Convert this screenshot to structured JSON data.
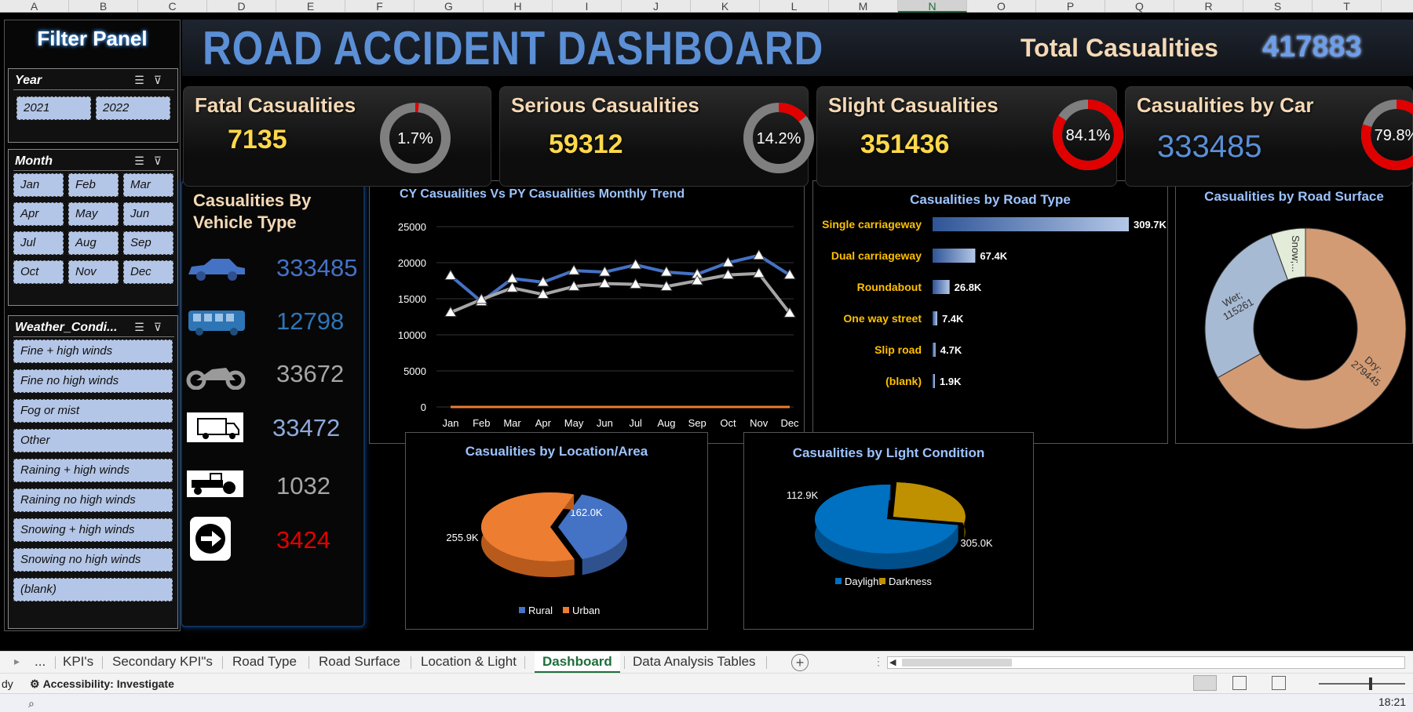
{
  "columns": [
    "A",
    "B",
    "C",
    "D",
    "E",
    "F",
    "G",
    "H",
    "I",
    "J",
    "K",
    "L",
    "M",
    "N",
    "O",
    "P",
    "Q",
    "R",
    "S",
    "T"
  ],
  "filter_panel": {
    "title": "Filter Panel"
  },
  "slicers": {
    "year": {
      "title": "Year",
      "items": [
        "2021",
        "2022"
      ]
    },
    "month": {
      "title": "Month",
      "items": [
        "Jan",
        "Feb",
        "Mar",
        "Apr",
        "May",
        "Jun",
        "Jul",
        "Aug",
        "Sep",
        "Oct",
        "Nov",
        "Dec"
      ]
    },
    "weather": {
      "title": "Weather_Condi...",
      "items": [
        "Fine + high winds",
        "Fine no high winds",
        "Fog or mist",
        "Other",
        "Raining + high winds",
        "Raining no high winds",
        "Snowing + high winds",
        "Snowing no high winds",
        "(blank)"
      ]
    }
  },
  "header": {
    "title": "ROAD ACCIDENT DASHBOARD",
    "total_label": "Total Casualities",
    "total_value": "417883"
  },
  "kpis": [
    {
      "title": "Fatal Casualities",
      "value": "7135",
      "pct_label": "1.7%",
      "pct": 1.7
    },
    {
      "title": "Serious Casualities",
      "value": "59312",
      "pct_label": "14.2%",
      "pct": 14.2
    },
    {
      "title": "Slight Casualities",
      "value": "351436",
      "pct_label": "84.1%",
      "pct": 84.1
    },
    {
      "title": "Casualities by Car",
      "value": "333485",
      "pct_label": "79.8%",
      "pct": 79.8
    }
  ],
  "vehicle_type": {
    "title_line1": "Casualities By",
    "title_line2": "Vehicle Type",
    "rows": [
      {
        "icon": "car-icon",
        "value": "333485",
        "color": "#4472c4"
      },
      {
        "icon": "bus-icon",
        "value": "12798",
        "color": "#2e75b6"
      },
      {
        "icon": "motorcycle-icon",
        "value": "33672",
        "color": "#a6a6a6"
      },
      {
        "icon": "van-icon",
        "value": "33472",
        "color": "#8ea9db"
      },
      {
        "icon": "tractor-icon",
        "value": "1032",
        "color": "#a6a6a6"
      },
      {
        "icon": "other-vehicle-icon",
        "value": "3424",
        "color": "#e00000"
      }
    ]
  },
  "chart_data": [
    {
      "type": "line",
      "title": "CY Casualities Vs PY Casualities Monthly Trend",
      "categories": [
        "Jan",
        "Feb",
        "Mar",
        "Apr",
        "May",
        "Jun",
        "Jul",
        "Aug",
        "Sep",
        "Oct",
        "Nov",
        "Dec"
      ],
      "series": [
        {
          "values": [
            18200,
            14600,
            17800,
            17300,
            18900,
            18700,
            19700,
            18700,
            18400,
            20000,
            21000,
            18300
          ],
          "color": "#4472c4"
        },
        {
          "values": [
            13100,
            14900,
            16500,
            15600,
            16700,
            17100,
            17000,
            16700,
            17500,
            18300,
            18500,
            13000
          ],
          "color": "#a6a6a6"
        },
        {
          "values": [
            0,
            0,
            0,
            0,
            0,
            0,
            0,
            0,
            0,
            0,
            0,
            0
          ],
          "color": "#ed7d31"
        }
      ],
      "yticks": [
        "25000",
        "20000",
        "15000",
        "10000",
        "5000",
        "0"
      ],
      "ylim": [
        0,
        25000
      ]
    },
    {
      "type": "bar",
      "title": "Casualities by Road Type",
      "categories": [
        "Single carriageway",
        "Dual carriageway",
        "Roundabout",
        "One way street",
        "Slip road",
        "(blank)"
      ],
      "values": [
        309.7,
        67.4,
        26.8,
        7.4,
        4.7,
        1.9
      ],
      "labels": [
        "309.7K",
        "67.4K",
        "26.8K",
        "7.4K",
        "4.7K",
        "1.9K"
      ]
    },
    {
      "type": "pie",
      "title": "Casualities by Road Surface",
      "slices": [
        {
          "label": "Dry; 279445",
          "value": 279445,
          "color": "#d39b74"
        },
        {
          "label": "Wet; 115261",
          "value": 115261,
          "color": "#a7bad3"
        },
        {
          "label": "Snow;...",
          "value": 23177,
          "color": "#e2ecd8"
        }
      ]
    },
    {
      "type": "pie",
      "title": "Casualities by Location/Area",
      "slices": [
        {
          "name": "Rural",
          "label": "162.0K",
          "value": 162.0,
          "color": "#4472c4"
        },
        {
          "name": "Urban",
          "label": "255.9K",
          "value": 255.9,
          "color": "#ed7d31"
        }
      ]
    },
    {
      "type": "pie",
      "title": "Casualities by Light Condition",
      "slices": [
        {
          "name": "Daylight",
          "label": "305.0K",
          "value": 305.0,
          "color": "#0070c0"
        },
        {
          "name": "Darkness",
          "label": "112.9K",
          "value": 112.9,
          "color": "#bf9000"
        }
      ]
    }
  ],
  "tabs": {
    "items": [
      "...",
      "KPI's",
      "Secondary KPI\"s",
      "Road Type",
      "Road Surface",
      "Location & Light",
      "Dashboard",
      "Data Analysis Tables"
    ],
    "active": "Dashboard"
  },
  "status": {
    "ready": "dy",
    "accessibility": "Accessibility: Investigate"
  },
  "taskbar": {
    "time": "18:21"
  }
}
